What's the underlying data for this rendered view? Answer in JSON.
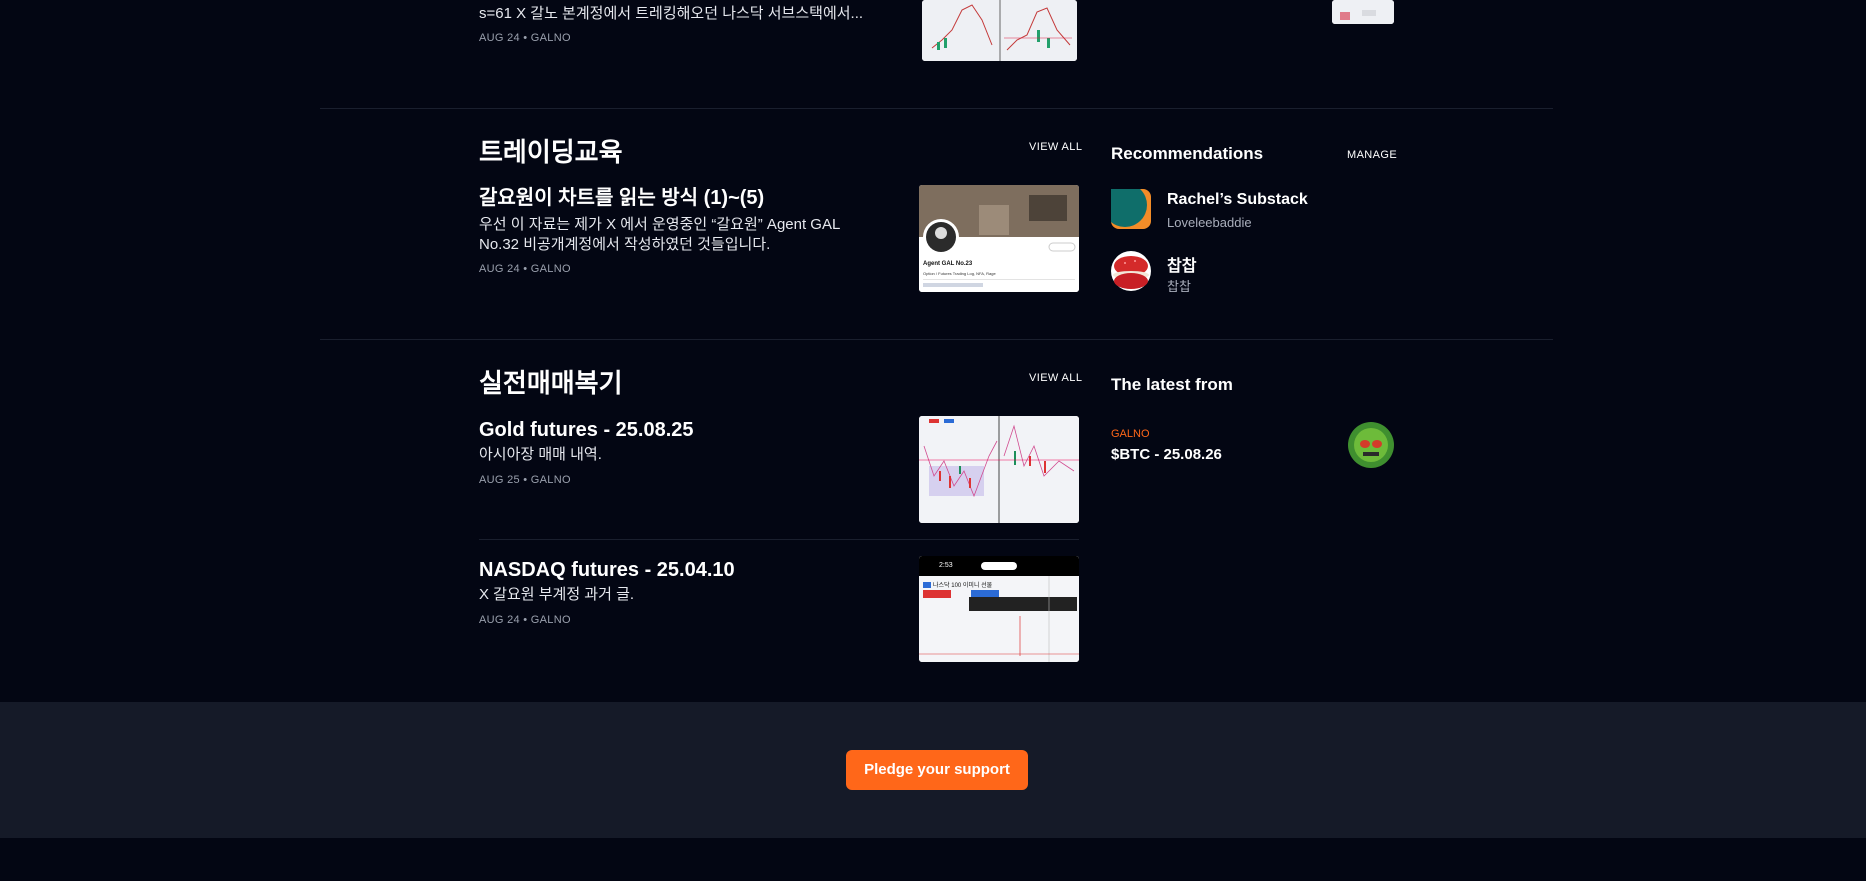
{
  "top_post": {
    "subtitle": "s=61 X 갈노 본계정에서 트레킹해오던 나스닥 서브스택에서...",
    "meta": "AUG 24 • GALNO"
  },
  "section_education": {
    "title": "트레이딩교육",
    "view_all": "VIEW ALL",
    "post": {
      "title": "갈요원이 차트를 읽는 방식 (1)~(5)",
      "subtitle_line1": "우선 이 자료는 제가 X 에서 운영중인 “갈요원” Agent GAL",
      "subtitle_line2": "No.32 비공개계정에서 작성하였던 것들입니다.",
      "meta": "AUG 24 • GALNO",
      "thumb_caption": "Agent GAL No.23",
      "thumb_desc": "Option / Futures Trading Log, NFA, Rage"
    }
  },
  "section_trading": {
    "title": "실전매매복기",
    "view_all": "VIEW ALL",
    "posts": [
      {
        "title": "Gold futures - 25.08.25",
        "subtitle": "아시아장 매매 내역.",
        "meta": "AUG 25 • GALNO"
      },
      {
        "title": "NASDAQ futures - 25.04.10",
        "subtitle": "X 갈요원 부계정 과거 글.",
        "meta": "AUG 24 • GALNO"
      }
    ],
    "phone_time": "2:53",
    "phone_chart_label": "나스닥 100 이미니 선물"
  },
  "recommendations": {
    "title": "Recommendations",
    "manage": "MANAGE",
    "items": [
      {
        "name": "Rachel’s Substack",
        "handle": "Loveleebaddie",
        "icon": "rachel-avatar-icon"
      },
      {
        "name": "찹찹",
        "handle": "찹찹",
        "icon": "macaron-avatar-icon"
      }
    ]
  },
  "latest": {
    "title": "The latest from",
    "author": "GALNO",
    "post_title": "$BTC - 25.08.26"
  },
  "footer": {
    "pledge_label": "Pledge your support"
  },
  "colors": {
    "background": "#030613",
    "accent": "#ff6719",
    "footer_band": "#151a28"
  }
}
